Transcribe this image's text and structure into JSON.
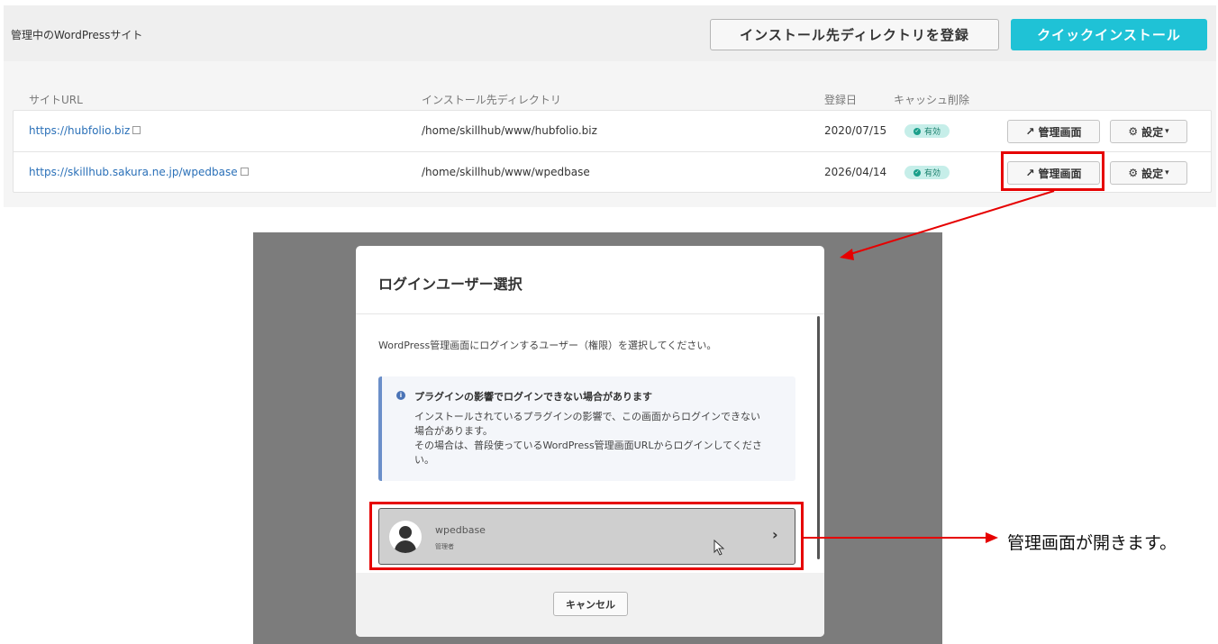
{
  "header": {
    "title": "管理中のWordPressサイト",
    "register_button": "インストール先ディレクトリを登録",
    "quick_install_button": "クイックインストール"
  },
  "table": {
    "columns": [
      "サイトURL",
      "インストール先ディレクトリ",
      "登録日",
      "キャッシュ削除"
    ],
    "rows": [
      {
        "url": "https://hubfolio.biz",
        "directory": "/home/skillhub/www/hubfolio.biz",
        "date": "2020/07/15",
        "cache": "有効",
        "admin_button": "管理画面",
        "settings_button": "設定"
      },
      {
        "url": "https://skillhub.sakura.ne.jp/wpedbase",
        "directory": "/home/skillhub/www/wpedbase",
        "date": "2026/04/14",
        "cache": "有効",
        "admin_button": "管理画面",
        "settings_button": "設定"
      }
    ]
  },
  "modal": {
    "title": "ログインユーザー選択",
    "description": "WordPress管理画面にログインするユーザー（権限）を選択してください。",
    "notice": {
      "title": "プラグインの影響でログインできない場合があります",
      "lines": [
        "インストールされているプラグインの影響で、この画面からログインできない",
        "場合があります。",
        "その場合は、普段使っているWordPress管理画面URLからログインしてくださ",
        "い。"
      ]
    },
    "user": {
      "name": "wpedbase",
      "role": "管理者"
    },
    "cancel_button": "キャンセル"
  },
  "annotation": {
    "callout": "管理画面が開きます。",
    "highlight_color": "#e60000"
  },
  "colors": {
    "accent": "#1fc2d6",
    "link": "#2a70b8",
    "badge_bg": "#c6eee9"
  }
}
